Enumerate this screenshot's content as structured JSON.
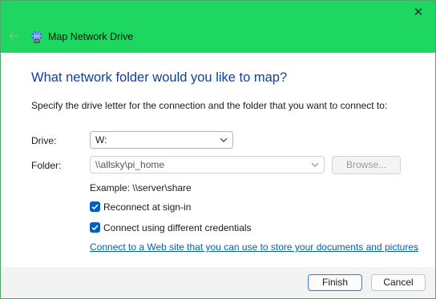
{
  "window": {
    "title": "Map Network Drive",
    "close_glyph": "✕",
    "accent": "#1ed760"
  },
  "page": {
    "heading": "What network folder would you like to map?",
    "description": "Specify the drive letter for the connection and the folder that you want to connect to:"
  },
  "form": {
    "drive_label": "Drive:",
    "drive_value": "W:",
    "folder_label": "Folder:",
    "folder_value": "\\\\allsky\\pi_home",
    "browse_label": "Browse...",
    "example": "Example: \\\\server\\share",
    "reconnect_label": "Reconnect at sign-in",
    "reconnect_checked": true,
    "credentials_label": "Connect using different credentials",
    "credentials_checked": true,
    "web_link": "Connect to a Web site that you can use to store your documents and pictures",
    "web_link_suffix": "."
  },
  "buttons": {
    "finish": "Finish",
    "cancel": "Cancel"
  }
}
